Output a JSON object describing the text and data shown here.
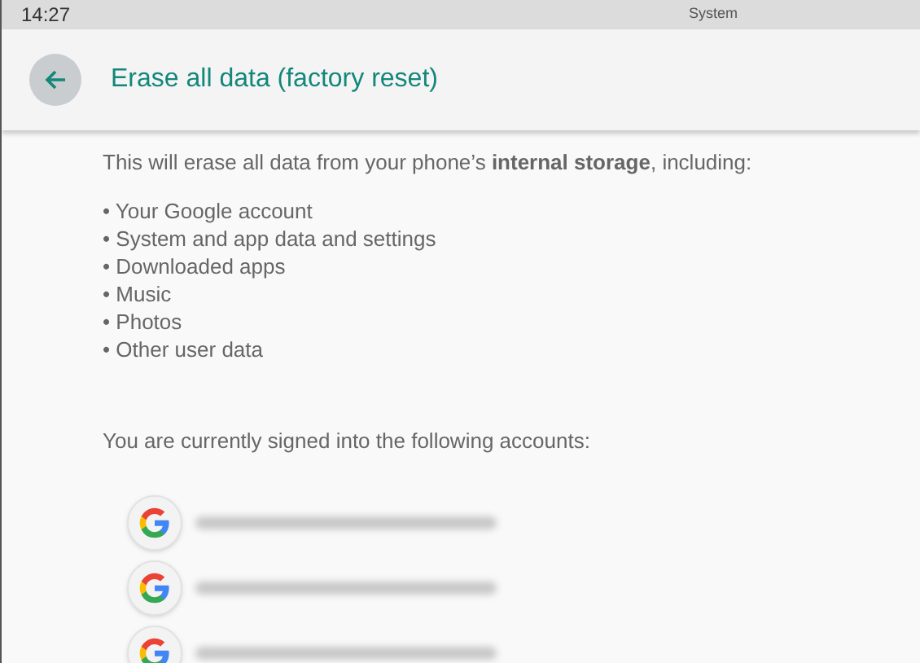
{
  "status_bar": {
    "time": "14:27",
    "label": "System"
  },
  "header": {
    "title": "Erase all data (factory reset)"
  },
  "intro": "This will erase all data from your phone’s **internal storage**, including:",
  "items": [
    "• Your Google account",
    "• System and app data and settings",
    "• Downloaded apps",
    "• Music",
    "• Photos",
    "• Other user data"
  ],
  "accounts_heading": "You are currently signed into the following accounts:",
  "accounts": [
    {
      "kind": "google"
    },
    {
      "kind": "google"
    },
    {
      "kind": "google"
    }
  ]
}
